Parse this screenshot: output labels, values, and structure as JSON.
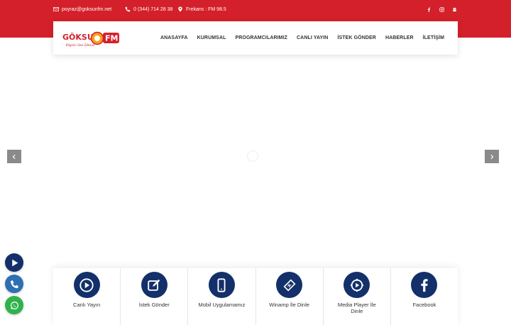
{
  "topbar": {
    "email": "poyraz@goksunfm.net",
    "phone": "0 (344) 714 28 38",
    "frequency": "Frekans : FM 98.5",
    "social": [
      "facebook-icon",
      "instagram-icon",
      "android-icon"
    ]
  },
  "logo": {
    "text_left": "GÖKSUN",
    "text_right": "FM",
    "tagline": "Bilginin Sesi Göksun"
  },
  "nav": {
    "items": [
      "ANASAYFA",
      "KURUMSAL",
      "PROGRAMCILARIMIZ",
      "CANLI YAYIN",
      "İSTEK GÖNDER",
      "HABERLER",
      "İLETİŞİM"
    ]
  },
  "services": [
    {
      "label": "Canlı Yayın",
      "icon": "play-icon"
    },
    {
      "label": "İstek Gönder",
      "icon": "edit-icon"
    },
    {
      "label": "Mobil Uygulamamız",
      "icon": "mobile-icon"
    },
    {
      "label": "Winamp İle Dinle",
      "icon": "winamp-icon"
    },
    {
      "label": "Media Player İle Dinle",
      "icon": "media-player-icon"
    },
    {
      "label": "Facebook",
      "icon": "facebook-icon"
    }
  ],
  "colors": {
    "brand_red": "#d4202a",
    "navy": "#13306a",
    "whatsapp": "#2fb24b",
    "phone": "#2f6fb3"
  }
}
